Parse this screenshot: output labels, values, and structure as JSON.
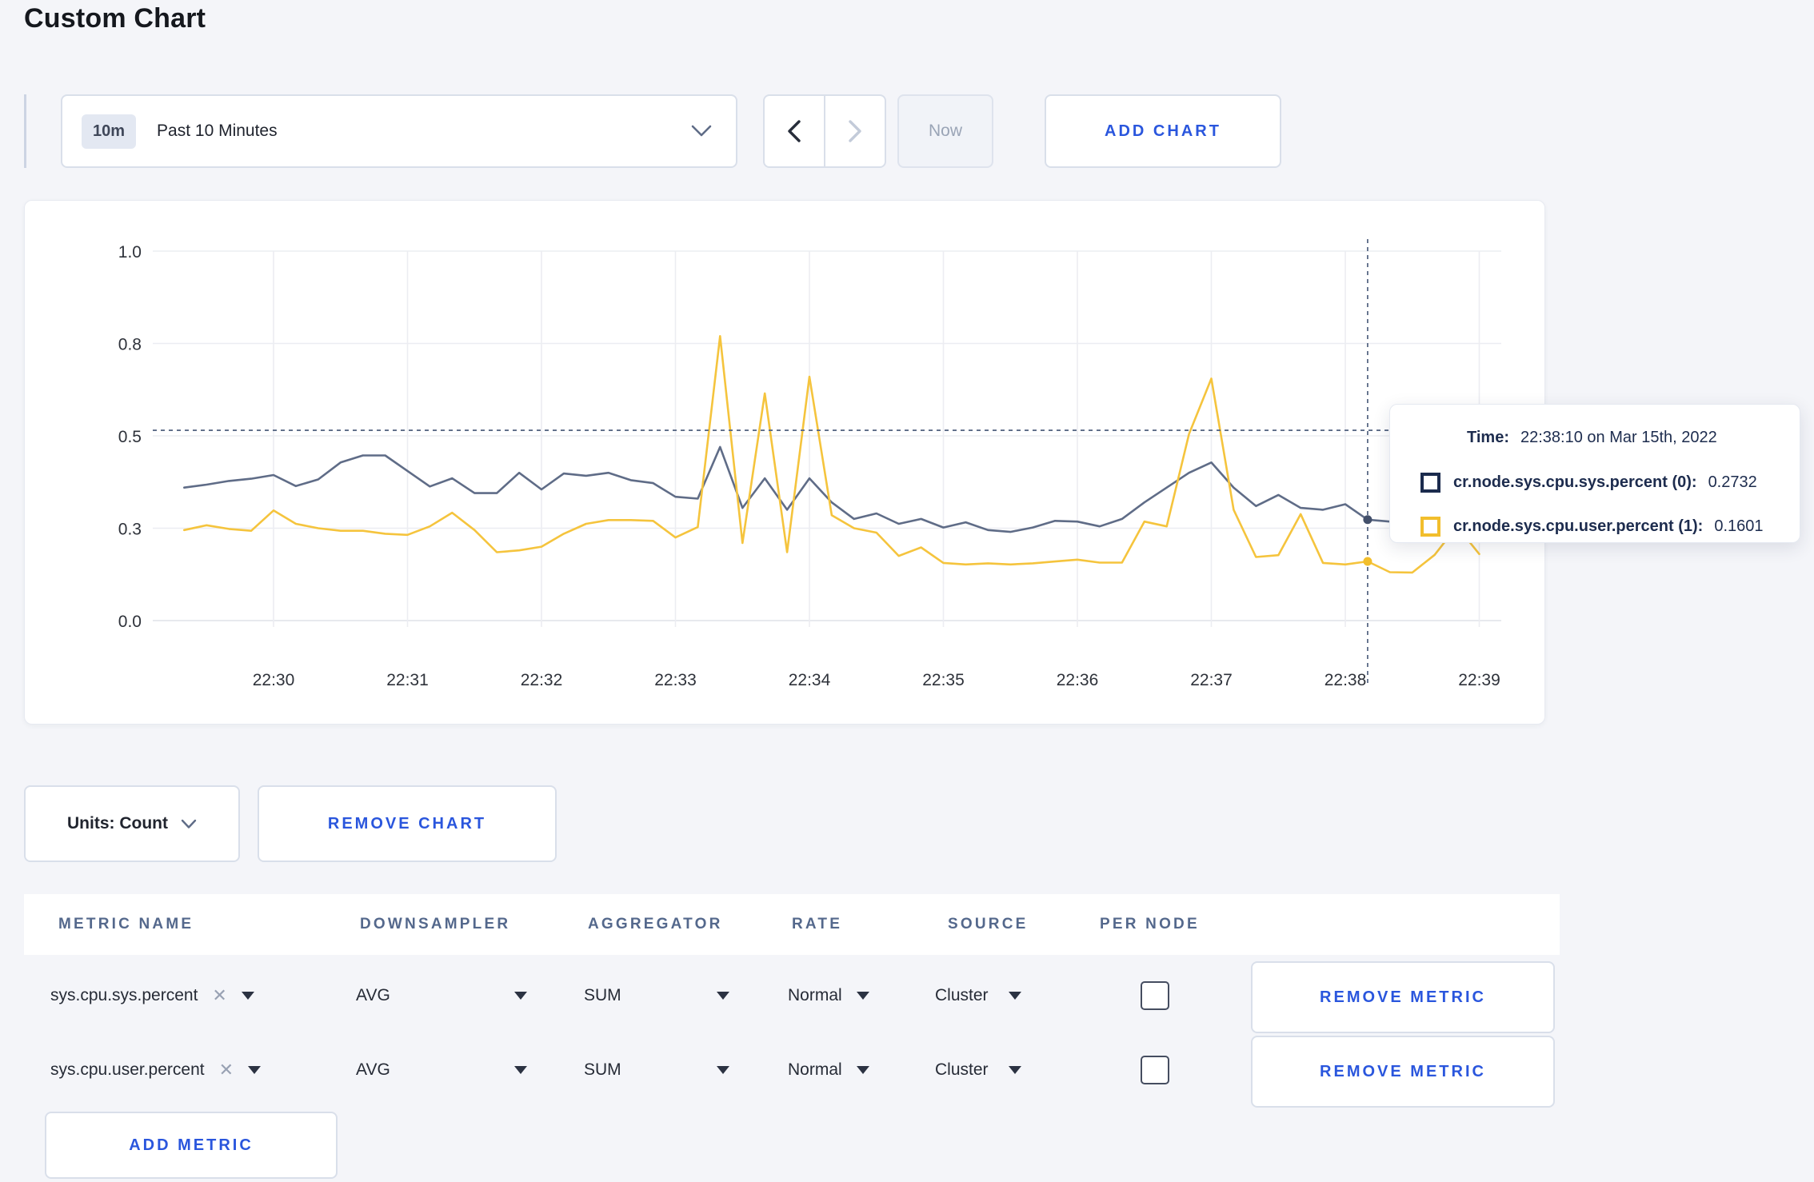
{
  "page": {
    "title": "Custom Chart"
  },
  "toolbar": {
    "range_badge": "10m",
    "range_label": "Past 10 Minutes",
    "now_label": "Now",
    "add_chart_label": "ADD CHART"
  },
  "icons": {
    "close_x": "✕"
  },
  "colors": {
    "accent_blue": "#2a56dd",
    "series_sys": "#5f6c87",
    "series_user": "#f5c43d",
    "swatch_sys": "#1b2b4d",
    "swatch_user": "#f2be2c",
    "page_background": "#f4f5f9"
  },
  "chart_data": {
    "type": "line",
    "title": "",
    "xlabel": "",
    "ylabel": "",
    "ylim": [
      0,
      1
    ],
    "grid": true,
    "legend_position": "tooltip",
    "y_ticks": [
      {
        "value": 0,
        "label": "0.0"
      },
      {
        "value": 0.25,
        "label": "0.3"
      },
      {
        "value": 0.5,
        "label": "0.5"
      },
      {
        "value": 0.75,
        "label": "0.8"
      },
      {
        "value": 1.0,
        "label": "1.0"
      }
    ],
    "x_ticks": [
      "22:30",
      "22:31",
      "22:32",
      "22:33",
      "22:34",
      "22:35",
      "22:36",
      "22:37",
      "22:38",
      "22:39"
    ],
    "x_start": "22:29:20",
    "x_step_seconds": 10,
    "crosshair": {
      "time": "22:38:10",
      "h_line_value": 0.515
    },
    "series": [
      {
        "name": "cr.node.sys.cpu.sys.percent (0)",
        "color": "#5f6c87",
        "dot_color": "#43506b",
        "values": [
          0.36,
          0.368,
          0.378,
          0.384,
          0.394,
          0.364,
          0.382,
          0.428,
          0.447,
          0.447,
          0.405,
          0.363,
          0.385,
          0.345,
          0.345,
          0.4,
          0.355,
          0.398,
          0.392,
          0.4,
          0.38,
          0.372,
          0.335,
          0.33,
          0.47,
          0.305,
          0.385,
          0.3,
          0.385,
          0.32,
          0.275,
          0.29,
          0.262,
          0.275,
          0.252,
          0.266,
          0.245,
          0.24,
          0.252,
          0.27,
          0.268,
          0.255,
          0.275,
          0.32,
          0.36,
          0.4,
          0.428,
          0.36,
          0.31,
          0.34,
          0.305,
          0.3,
          0.315,
          0.2732,
          0.268,
          0.272,
          0.28,
          0.285,
          0.282
        ]
      },
      {
        "name": "cr.node.sys.cpu.user.percent (1)",
        "color": "#f5c43d",
        "dot_color": "#f2be2c",
        "values": [
          0.245,
          0.258,
          0.248,
          0.243,
          0.298,
          0.262,
          0.25,
          0.243,
          0.243,
          0.235,
          0.232,
          0.255,
          0.292,
          0.245,
          0.185,
          0.19,
          0.2,
          0.235,
          0.262,
          0.272,
          0.272,
          0.27,
          0.225,
          0.253,
          0.77,
          0.21,
          0.615,
          0.185,
          0.66,
          0.285,
          0.25,
          0.238,
          0.175,
          0.198,
          0.156,
          0.152,
          0.155,
          0.152,
          0.155,
          0.16,
          0.165,
          0.157,
          0.157,
          0.268,
          0.255,
          0.505,
          0.655,
          0.3,
          0.172,
          0.177,
          0.288,
          0.156,
          0.152,
          0.1601,
          0.131,
          0.13,
          0.178,
          0.255,
          0.18
        ]
      }
    ]
  },
  "tooltip": {
    "time_label": "Time:",
    "time_value": "22:38:10 on Mar 15th, 2022",
    "series": [
      {
        "label": "cr.node.sys.cpu.sys.percent (0):",
        "value": "0.2732",
        "swatch_color": "#1b2b4d"
      },
      {
        "label": "cr.node.sys.cpu.user.percent (1):",
        "value": "0.1601",
        "swatch_color": "#f2be2c"
      }
    ]
  },
  "chart_controls": {
    "units_label": "Units: Count",
    "remove_chart_label": "REMOVE CHART"
  },
  "metrics_table": {
    "headers": [
      "METRIC NAME",
      "DOWNSAMPLER",
      "AGGREGATOR",
      "RATE",
      "SOURCE",
      "PER NODE"
    ],
    "rows": [
      {
        "metric": "sys.cpu.sys.percent",
        "downsampler": "AVG",
        "aggregator": "SUM",
        "rate": "Normal",
        "source": "Cluster",
        "per_node_checked": false,
        "remove_label": "REMOVE METRIC"
      },
      {
        "metric": "sys.cpu.user.percent",
        "downsampler": "AVG",
        "aggregator": "SUM",
        "rate": "Normal",
        "source": "Cluster",
        "per_node_checked": false,
        "remove_label": "REMOVE METRIC"
      }
    ],
    "add_metric_label": "ADD METRIC"
  }
}
